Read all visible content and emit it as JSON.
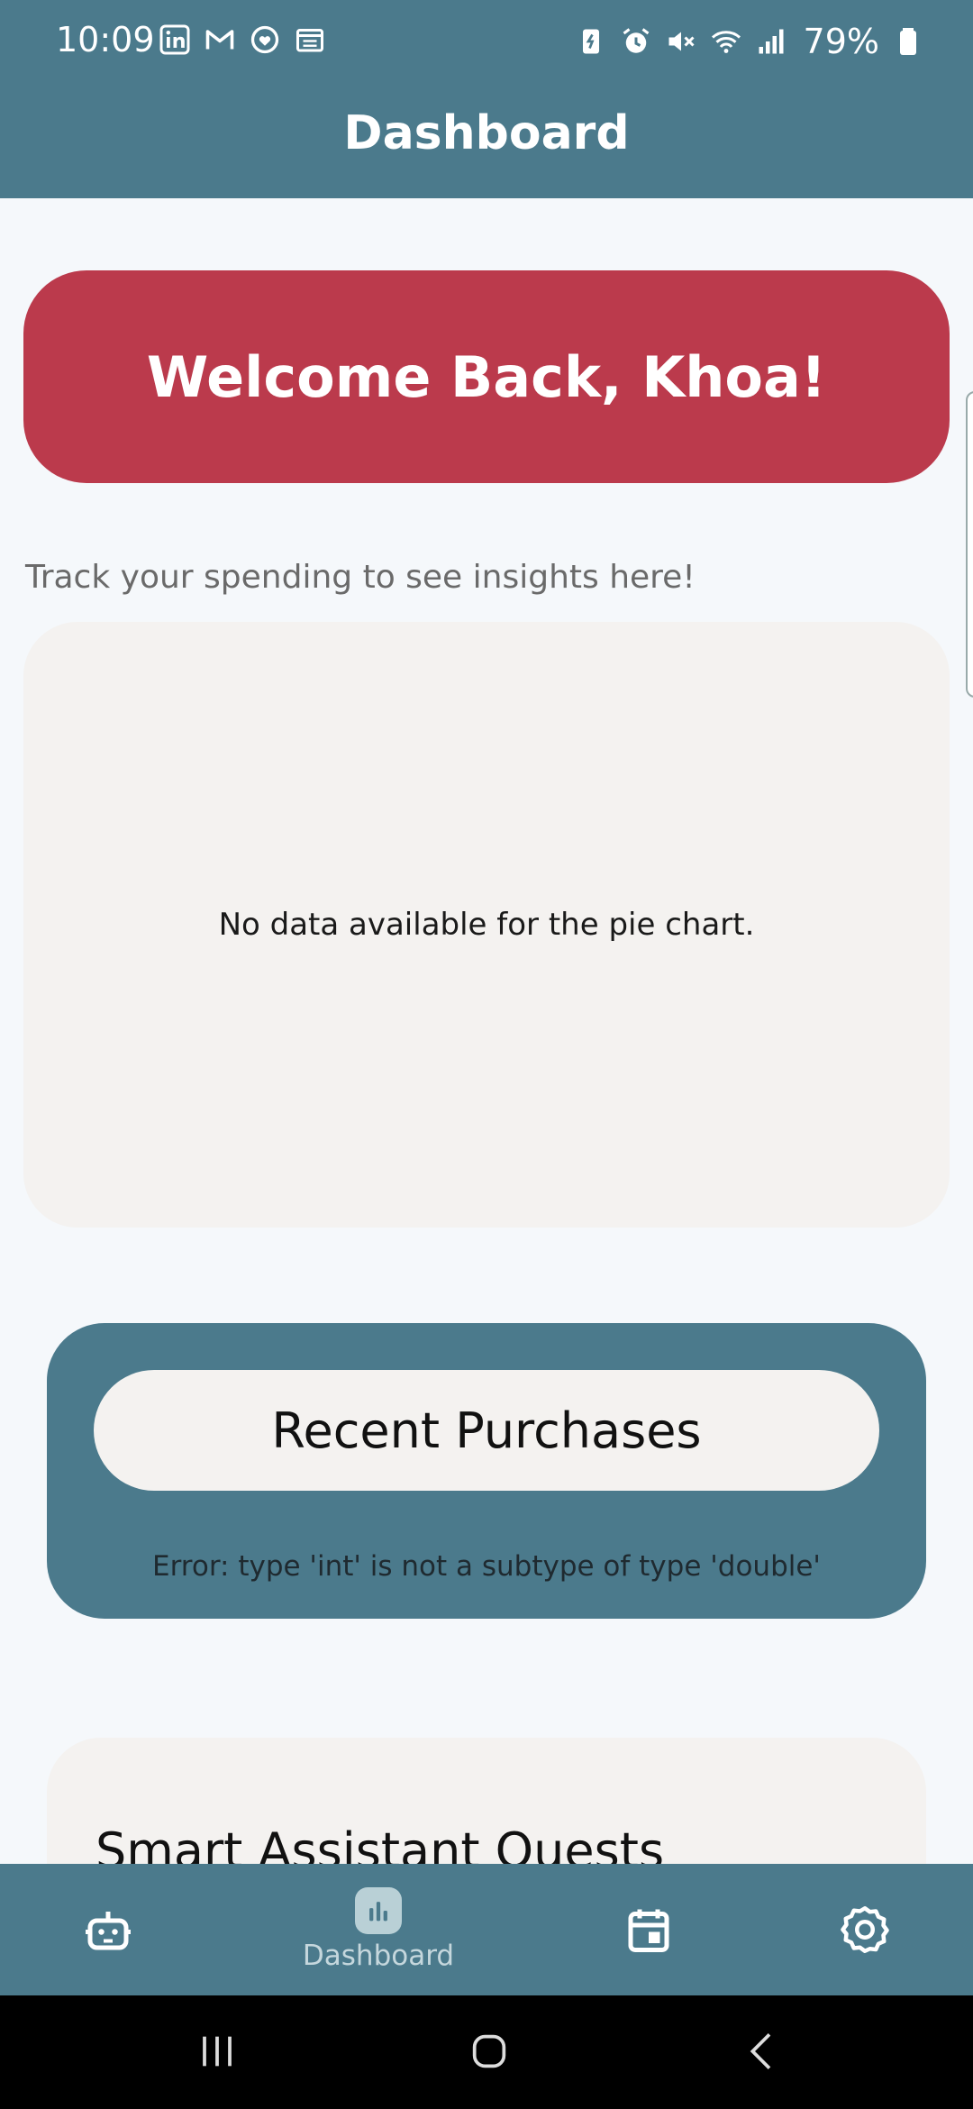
{
  "status_bar": {
    "time": "10:09",
    "battery": "79%",
    "left_icons": [
      "linkedin-icon",
      "gmail-icon",
      "heart-app-icon",
      "calendar-app-icon"
    ],
    "right_icons": [
      "battery-saver-icon",
      "alarm-icon",
      "mute-icon",
      "wifi-icon",
      "signal-icon",
      "battery-icon"
    ]
  },
  "app_bar": {
    "title": "Dashboard"
  },
  "welcome": {
    "text": "Welcome Back, Khoa!"
  },
  "insights": {
    "prompt": "Track your spending to see insights here!",
    "empty_message": "No data available for the pie chart."
  },
  "recent_purchases": {
    "title": "Recent Purchases",
    "error": "Error: type 'int' is not a subtype of type 'double'"
  },
  "quests": {
    "title": "Smart Assistant Quests"
  },
  "bottom_nav": {
    "items": [
      {
        "icon": "robot-icon",
        "label": ""
      },
      {
        "icon": "bar-chart-icon",
        "label": "Dashboard",
        "active": true
      },
      {
        "icon": "calendar-icon",
        "label": ""
      },
      {
        "icon": "settings-icon",
        "label": ""
      }
    ]
  },
  "colors": {
    "primary": "#4b7a8c",
    "welcome_bg": "#bb3a4c",
    "card_bg": "#f4f2f0",
    "page_bg": "#f5f8fb"
  }
}
